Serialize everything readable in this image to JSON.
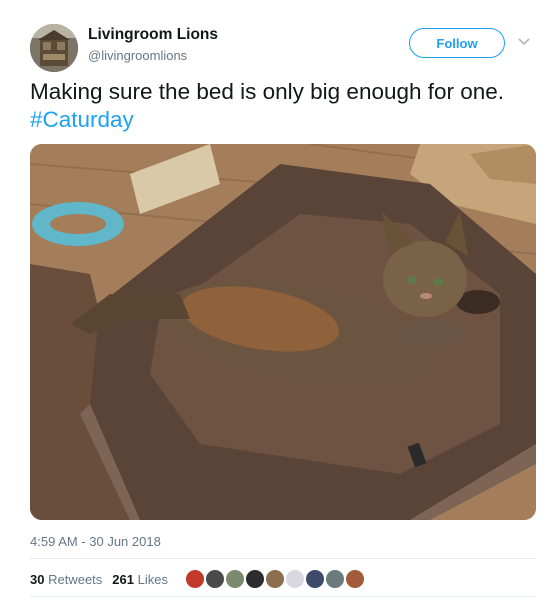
{
  "user": {
    "display_name": "Livingroom Lions",
    "handle": "@livingroomlions"
  },
  "follow_label": "Follow",
  "tweet": {
    "text_before": "Making sure the bed is only big enough for one. ",
    "hashtag": "#Caturday"
  },
  "media": {
    "alt": "Tabby cat lying in a brown pet bed"
  },
  "timestamp": "4:59 AM - 30 Jun 2018",
  "stats": {
    "retweets_count": "30",
    "retweets_label": "Retweets",
    "likes_count": "261",
    "likes_label": "Likes"
  },
  "colors": {
    "accent": "#1da1f2",
    "muted": "#657786",
    "text": "#14171a"
  },
  "icons": {
    "more": "chevron-down-icon"
  }
}
